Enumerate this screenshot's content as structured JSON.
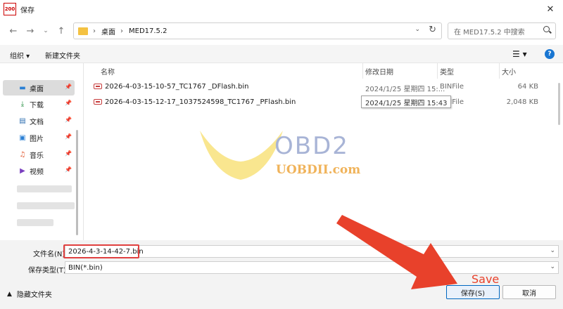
{
  "window": {
    "title": "保存",
    "app_icon_text": "200"
  },
  "address": {
    "crumbs": [
      "桌面",
      "MED17.5.2"
    ],
    "search_placeholder": "在 MED17.5.2 中搜索"
  },
  "toolbar": {
    "organize_label": "组织 ▾",
    "new_folder_label": "新建文件夹",
    "view_icon": "list-view-icon",
    "help_label": "?"
  },
  "sidebar": {
    "items": [
      {
        "label": "桌面",
        "icon": "desktop-icon",
        "pinned": true,
        "selected": true
      },
      {
        "label": "下载",
        "icon": "download-icon",
        "pinned": true
      },
      {
        "label": "文档",
        "icon": "document-icon",
        "pinned": true
      },
      {
        "label": "图片",
        "icon": "picture-icon",
        "pinned": true
      },
      {
        "label": "音乐",
        "icon": "music-icon",
        "pinned": true
      },
      {
        "label": "视频",
        "icon": "video-icon",
        "pinned": true
      }
    ]
  },
  "file_list": {
    "columns": [
      "名称",
      "修改日期",
      "类型",
      "大小"
    ],
    "rows": [
      {
        "name": "2026-4-03-15-10-57_TC1767 _DFlash.bin",
        "date": "2024/1/25 星期四 15:...",
        "type": "BINFile",
        "size": "64 KB"
      },
      {
        "name": "2026-4-03-15-12-17_1037524598_TC1767 _PFlash.bin",
        "date": "",
        "type": "BINFile",
        "size": "2,048 KB"
      }
    ],
    "tooltip": "2024/1/25 星期四 15:43"
  },
  "watermark": {
    "brand": "OBD2",
    "site": "UOBDII.com"
  },
  "form": {
    "filename_label": "文件名(N):",
    "filename_value": "2026-4-3-14-42-7.bin",
    "filetype_label": "保存类型(T):",
    "filetype_value": "BIN(*.bin)"
  },
  "footer": {
    "hide_folders_label": "隐藏文件夹",
    "save_label": "保存(S)",
    "cancel_label": "取消"
  },
  "annotation": {
    "save_text": "Save",
    "color": "#e8412b"
  }
}
